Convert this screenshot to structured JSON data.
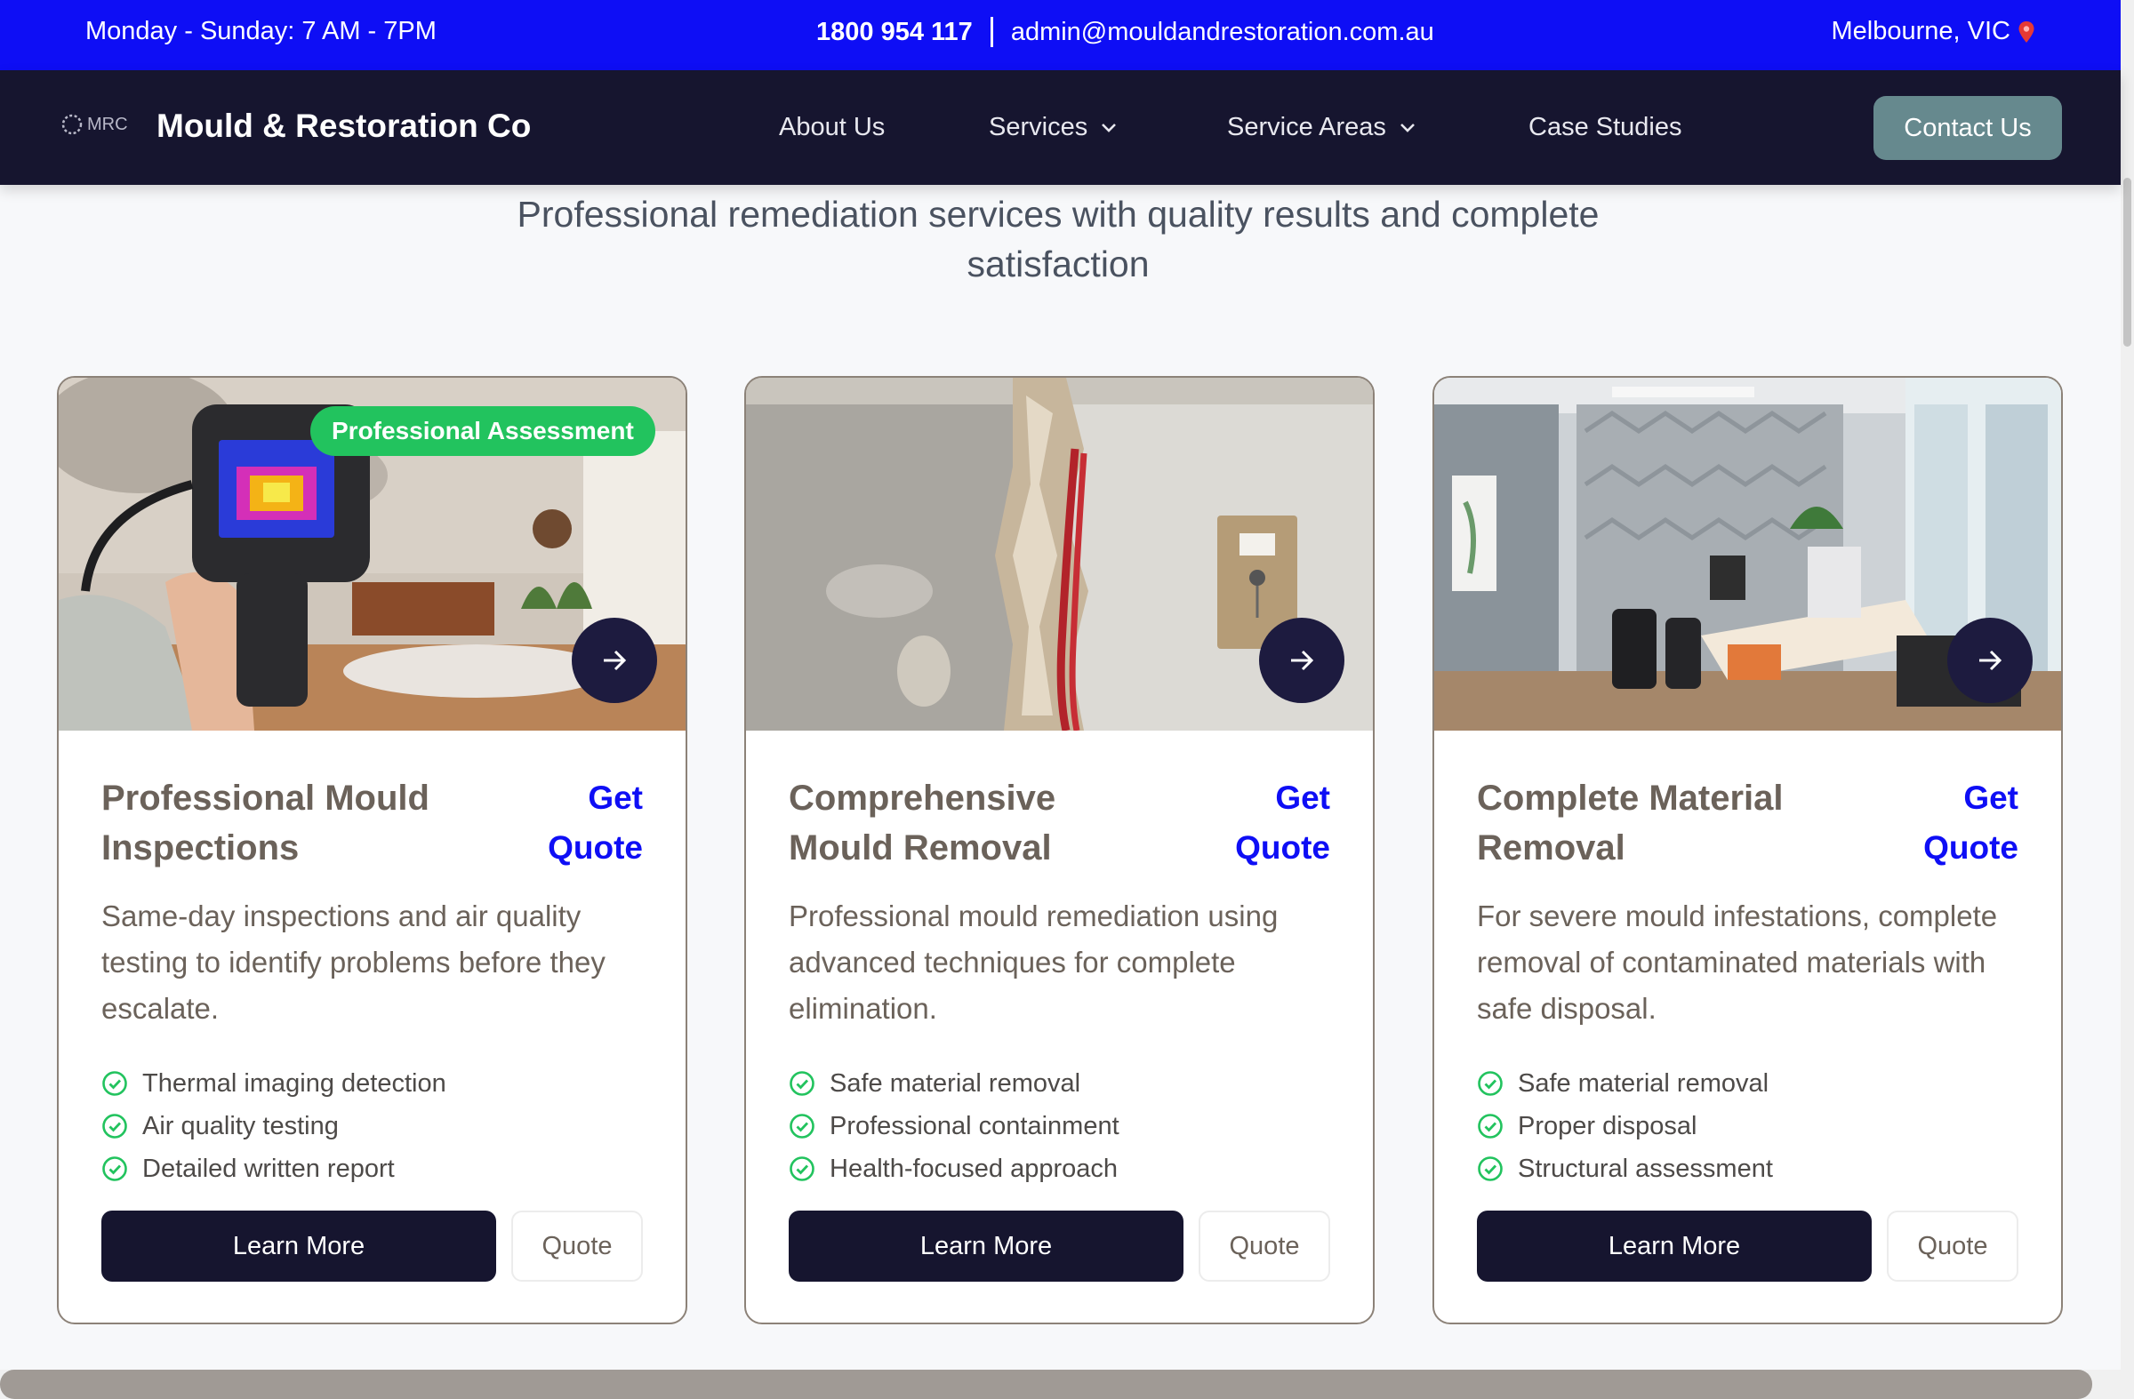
{
  "topbar": {
    "hours": "Monday - Sunday: 7 AM - 7PM",
    "phone": "1800 954 117",
    "email": "admin@mouldandrestoration.com.au",
    "location": "Melbourne, VIC",
    "location_icon": "pin-icon"
  },
  "nav": {
    "logo_text": "MRC",
    "brand": "Mould & Restoration Co",
    "links": [
      "About Us",
      "Services",
      "Service Areas",
      "Case Studies"
    ],
    "contact": "Contact Us"
  },
  "intro": {
    "subtitle": "Professional remediation services with quality results and complete satisfaction"
  },
  "cards": [
    {
      "badge": "Professional Assessment",
      "title": "Professional Mould Inspections",
      "get_quote": "Get Quote",
      "description": "Same-day inspections and air quality testing to identify problems before they escalate.",
      "features": [
        "Thermal imaging detection",
        "Air quality testing",
        "Detailed written report"
      ],
      "learn_more": "Learn More",
      "quote": "Quote"
    },
    {
      "title": "Comprehensive Mould Removal",
      "get_quote": "Get Quote",
      "description": "Professional mould remediation using advanced techniques for complete elimination.",
      "features": [
        "Safe material removal",
        "Professional containment",
        "Health-focused approach"
      ],
      "learn_more": "Learn More",
      "quote": "Quote"
    },
    {
      "title": "Complete Material Removal",
      "get_quote": "Get Quote",
      "description": "For severe mould infestations, complete removal of contaminated materials with safe disposal.",
      "features": [
        "Safe material removal",
        "Proper disposal",
        "Structural assessment"
      ],
      "learn_more": "Learn More",
      "quote": "Quote"
    }
  ],
  "colors": {
    "topbar": "#0e0ef5",
    "navbar": "#16152f",
    "contact_button": "#66898e",
    "badge": "#22c35e",
    "check": "#22c35e",
    "link": "#0e0ef5"
  }
}
